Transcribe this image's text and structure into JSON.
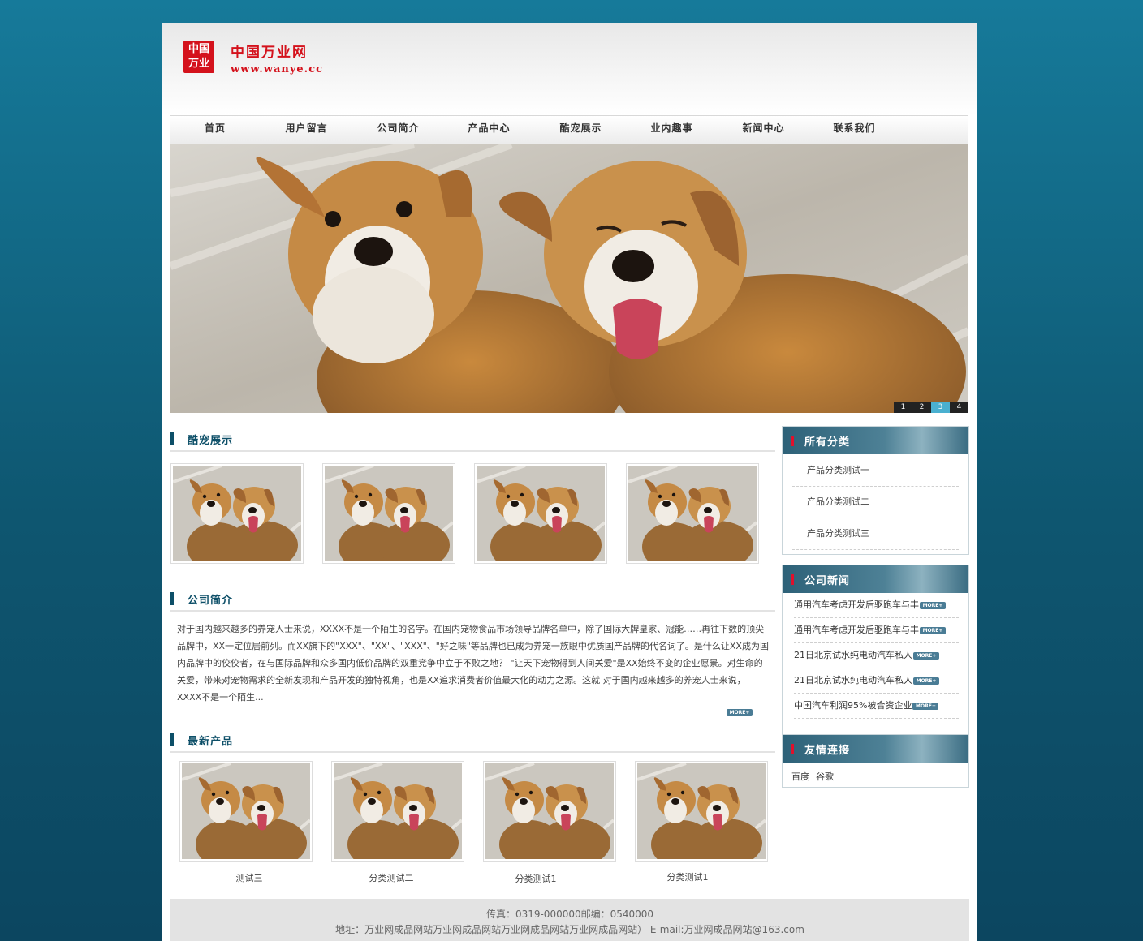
{
  "logo": {
    "seal_line1": "中国",
    "seal_line2": "万业",
    "name": "中国万业网",
    "url": "www.wanye.cc"
  },
  "nav": [
    "首页",
    "用户留言",
    "公司简介",
    "产品中心",
    "酷宠展示",
    "业内趣事",
    "新闻中心",
    "联系我们"
  ],
  "slider": {
    "pages": [
      "1",
      "2",
      "3",
      "4"
    ],
    "active": "3"
  },
  "sections": {
    "pets": "酷宠展示",
    "intro": "公司简介",
    "products": "最新产品"
  },
  "intro_text": "对于国内越来越多的养宠人士来说，XXXX不是一个陌生的名字。在国内宠物食品市场领导品牌名单中，除了国际大牌皇家、冠能……再往下数的顶尖品牌中，XX一定位居前列。而XX旗下的\"XXX\"、\"XX\"、\"XXX\"、\"好之味\"等品牌也已成为养宠一族眼中优质国产品牌的代名词了。是什么让XX成为国内品牌中的佼佼者，在与国际品牌和众多国内低价品牌的双重竞争中立于不败之地？ \"让天下宠物得到人间关爱\"是XX始终不变的企业愿景。对生命的关爱，带来对宠物需求的全新发现和产品开发的独特视角，也是XX追求消费者价值最大化的动力之源。这就 对于国内越来越多的养宠人士来说，XXXX不是一个陌生...",
  "more_label": "MORE+",
  "products": [
    "测试三",
    "分类测试二",
    "分类测试1",
    "分类测试1"
  ],
  "sidebar": {
    "categories_title": "所有分类",
    "categories": [
      "产品分类测试一",
      "产品分类测试二",
      "产品分类测试三"
    ],
    "news_title": "公司新闻",
    "news": [
      "通用汽车考虑开发后驱跑车与丰",
      "通用汽车考虑开发后驱跑车与丰",
      "21日北京试水纯电动汽车私人",
      "21日北京试水纯电动汽车私人",
      "中国汽车利润95%被合资企业"
    ],
    "links_title": "友情连接",
    "links": [
      "百度",
      "谷歌"
    ]
  },
  "footer": {
    "line1": "传真：0319-000000邮编：0540000",
    "line2": "地址：万业网成品网站万业网成品网站万业网成品网站万业网成品网站）  E-mail:万业网成品网站@163.com"
  }
}
